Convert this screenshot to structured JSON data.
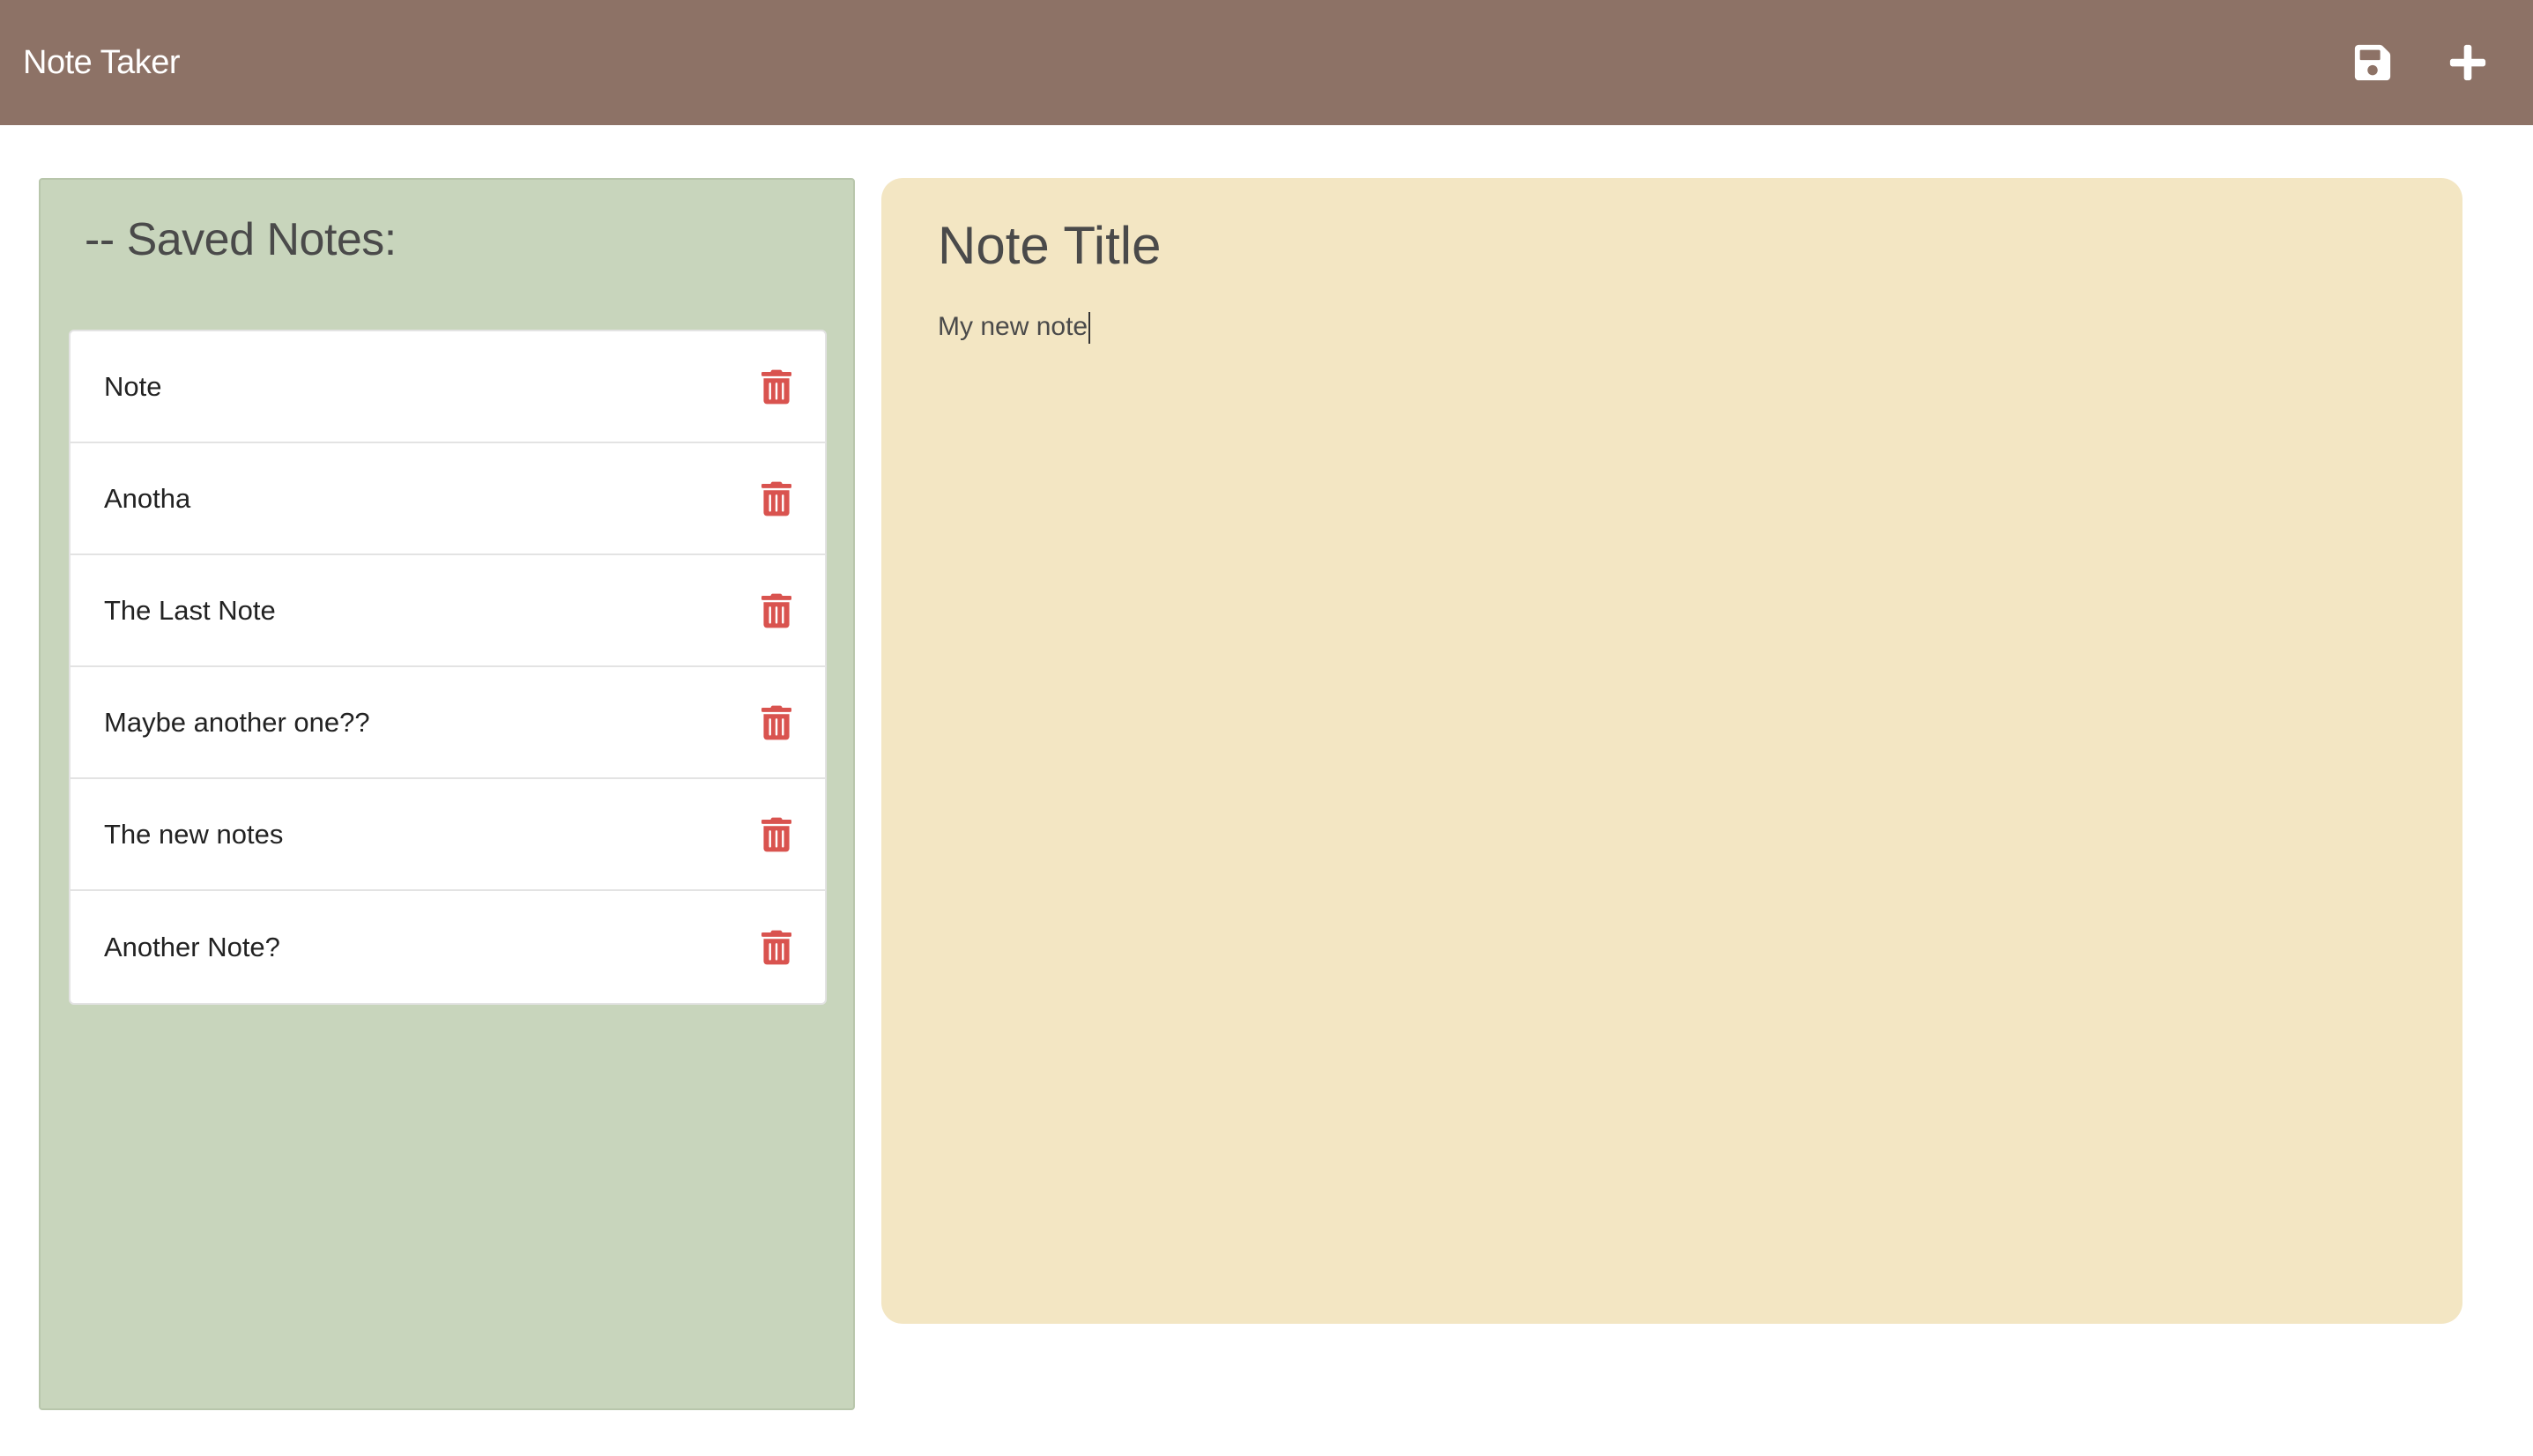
{
  "app": {
    "title": "Note Taker"
  },
  "toolbar": {
    "save_icon": "save-icon",
    "new_icon": "plus-icon"
  },
  "sidebar": {
    "title": "-- Saved Notes:",
    "notes": [
      {
        "label": "Note"
      },
      {
        "label": "Anotha"
      },
      {
        "label": "The Last Note"
      },
      {
        "label": "Maybe another one??"
      },
      {
        "label": "The new notes"
      },
      {
        "label": "Another Note?"
      }
    ]
  },
  "editor": {
    "title_placeholder": "Note Title",
    "text_value": "My new note"
  },
  "colors": {
    "navbar": "#8d7266",
    "sidebar": "#c8d5bc",
    "editor": "#f3e6c3",
    "trash": "#d9534f"
  }
}
